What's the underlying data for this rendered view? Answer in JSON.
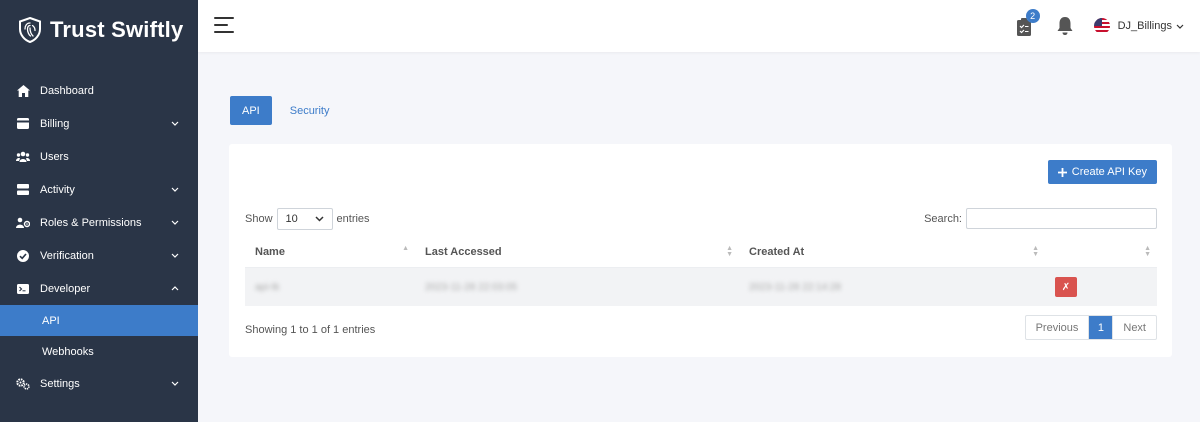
{
  "brand": {
    "name": "Trust Swiftly"
  },
  "sidebar": {
    "items": [
      {
        "label": "Dashboard",
        "icon": "home-icon",
        "chevron": false
      },
      {
        "label": "Billing",
        "icon": "billing-icon",
        "chevron": true
      },
      {
        "label": "Users",
        "icon": "users-icon",
        "chevron": false
      },
      {
        "label": "Activity",
        "icon": "activity-icon",
        "chevron": true
      },
      {
        "label": "Roles & Permissions",
        "icon": "roles-icon",
        "chevron": true
      },
      {
        "label": "Verification",
        "icon": "verification-icon",
        "chevron": true
      },
      {
        "label": "Developer",
        "icon": "developer-icon",
        "chevron": true,
        "expanded": true
      }
    ],
    "developer_sub": [
      {
        "label": "API",
        "active": true
      },
      {
        "label": "Webhooks",
        "active": false
      }
    ],
    "settings": {
      "label": "Settings",
      "icon": "settings-icon"
    }
  },
  "header": {
    "tasks_badge": "2",
    "user": "DJ_Billings"
  },
  "tabs": [
    {
      "label": "API",
      "active": true
    },
    {
      "label": "Security",
      "active": false
    }
  ],
  "card": {
    "create_label": "Create API Key",
    "show_label": "Show",
    "entries_label": "entries",
    "page_length": "10",
    "search_label": "Search:",
    "search_value": "",
    "columns": [
      "Name",
      "Last Accessed",
      "Created At"
    ],
    "rows": [
      {
        "name": "api-tk",
        "last_accessed": "2023-11-28 22:03:05",
        "created_at": "2023-11-28 22:14:28",
        "delete_label": "✗"
      }
    ],
    "info": "Showing 1 to 1 of 1 entries",
    "pagination": {
      "previous": "Previous",
      "current": "1",
      "next": "Next"
    }
  },
  "colors": {
    "sidebar_bg": "#2a3547",
    "accent": "#3d7cc9",
    "danger": "#d9534f",
    "page_bg": "#f5f6fa"
  }
}
